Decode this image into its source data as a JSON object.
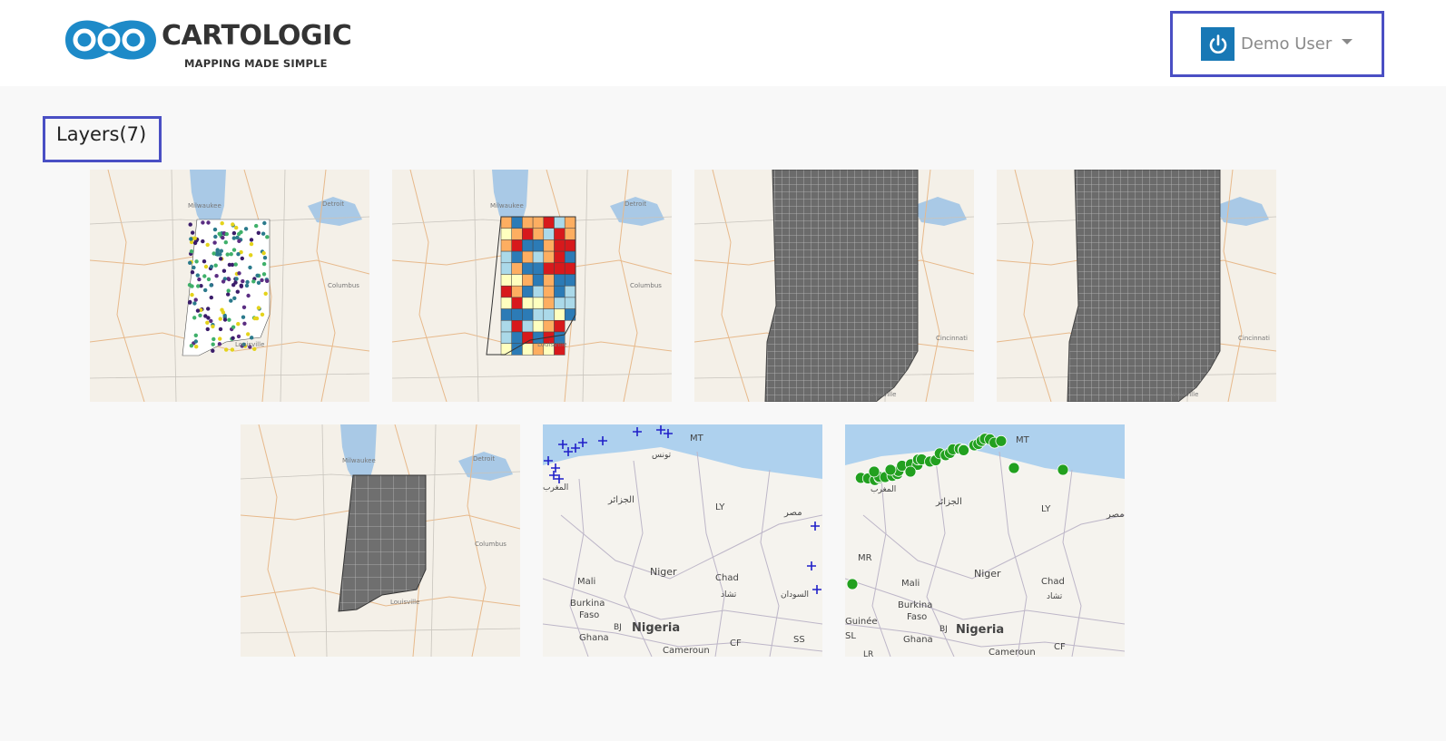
{
  "brand": {
    "name": "CARTOLOGIC",
    "tagline": "MAPPING MADE SIMPLE",
    "accent_color": "#1878b5"
  },
  "user_menu": {
    "label": "Demo User",
    "icon": "power-icon"
  },
  "layers": {
    "title": "Layers(7)",
    "items": [
      {
        "map": "indiana-points",
        "labels": [
          "Milwaukee",
          "Detroit",
          "Columbus",
          "Louisville"
        ]
      },
      {
        "map": "indiana-choropleth",
        "labels": [
          "Milwaukee",
          "Detroit",
          "Columbus",
          "Louisville"
        ]
      },
      {
        "map": "indiana-grid",
        "labels": [
          "Cincinnati",
          "Louisville"
        ]
      },
      {
        "map": "indiana-grid",
        "labels": [
          "Cincinnati",
          "Louisville"
        ]
      },
      {
        "map": "indiana-counties",
        "labels": [
          "Milwaukee",
          "Detroit",
          "Columbus",
          "Louisville"
        ]
      },
      {
        "map": "north-africa-crosses",
        "labels": [
          "MT",
          "تونس",
          "المغرب",
          "الجزائر",
          "LY",
          "مصر",
          "Mali",
          "Niger",
          "Chad",
          "تشاد",
          "السودان",
          "Burkina",
          "Faso",
          "BJ",
          "Nigeria",
          "Ghana",
          "Cameroun",
          "CF",
          "SS"
        ]
      },
      {
        "map": "north-africa-dots",
        "labels": [
          "MT",
          "المغرب",
          "الجزائر",
          "LY",
          "مصر",
          "MR",
          "Mali",
          "Niger",
          "Chad",
          "تشاد",
          "Burkina",
          "Faso",
          "Guinée",
          "BJ",
          "Nigeria",
          "Ghana",
          "Cameroun",
          "CF",
          "SL",
          "LR"
        ]
      }
    ]
  }
}
